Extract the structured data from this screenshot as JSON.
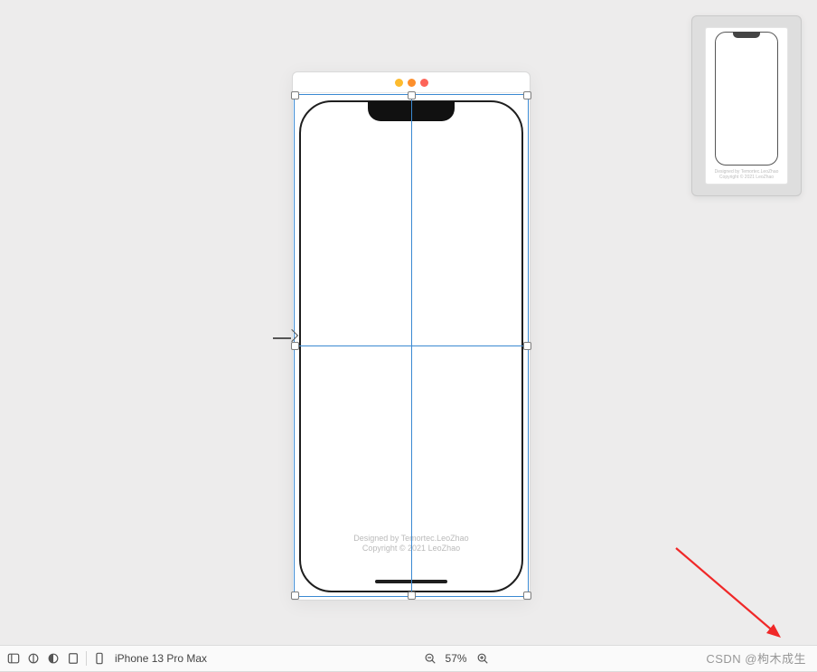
{
  "simulator": {
    "credits_line1": "Designed by Temortec.LeoZhao",
    "credits_line2": "Copyright © 2021 LeoZhao"
  },
  "thumb": {
    "credits_line1": "Designed by Temortec.LeoZhao",
    "credits_line2": "Copyright © 2021 LeoZhao"
  },
  "toolbar": {
    "device_label": "iPhone 13 Pro Max",
    "zoom_value": "57%"
  },
  "watermark": "CSDN @枸木成生"
}
